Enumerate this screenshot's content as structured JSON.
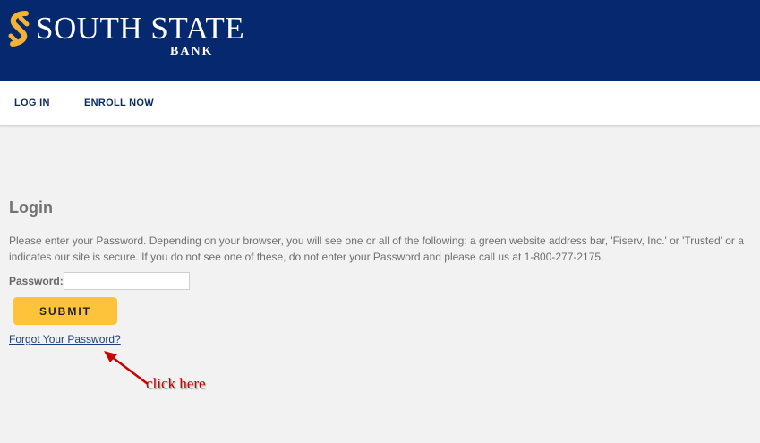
{
  "header": {
    "brand_name": "SOUTH STATE",
    "brand_sub": "BANK",
    "colors": {
      "background": "#06286e",
      "logo_accent": "#f5b233"
    }
  },
  "nav": {
    "items": [
      {
        "label": "LOG IN"
      },
      {
        "label": "ENROLL NOW"
      }
    ]
  },
  "login": {
    "title": "Login",
    "description_line1": "Please enter your Password. Depending on your browser, you will see one or all of the following: a green website address bar, 'Fiserv, Inc.' or 'Trusted' or a",
    "description_line2": "indicates our site is secure. If you do not see one of these, do not enter your Password and please call us at 1-800-277-2175.",
    "password_label": "Password:",
    "password_value": "",
    "submit_label": "SUBMIT",
    "forgot_label": "Forgot Your Password?",
    "submit_color": "#fcc33b"
  },
  "annotation": {
    "text": "click here",
    "color": "#cc0000",
    "icon": "arrow-icon"
  }
}
